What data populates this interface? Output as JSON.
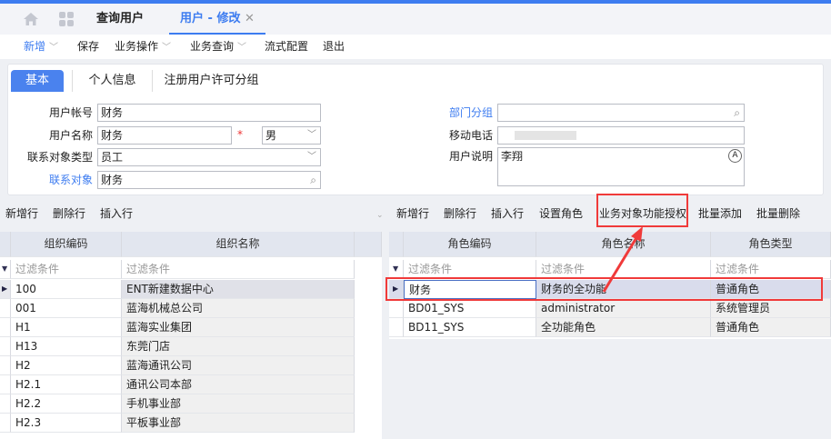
{
  "tabs": {
    "home_icon": "home-icon",
    "apps_icon": "grid-icon",
    "items": [
      {
        "label": "查询用户"
      },
      {
        "label": "用户 - 修改",
        "active": true
      }
    ],
    "close": "✕"
  },
  "toolbar": {
    "items": [
      "新增",
      "保存",
      "业务操作",
      "业务查询",
      "流式配置",
      "退出"
    ]
  },
  "form_tabs": [
    "基本",
    "个人信息",
    "注册用户许可分组"
  ],
  "form": {
    "user_account": {
      "label": "用户帐号",
      "value": "财务"
    },
    "user_name": {
      "label": "用户名称",
      "value": "财务",
      "required": "*"
    },
    "gender": {
      "value": "男"
    },
    "contact_type": {
      "label": "联系对象类型",
      "value": "员工"
    },
    "contact": {
      "label": "联系对象",
      "value": "财务"
    },
    "dept_group": {
      "label": "部门分组",
      "value": ""
    },
    "mobile": {
      "label": "移动电话",
      "value": ""
    },
    "description": {
      "label": "用户说明",
      "value": "李翔"
    }
  },
  "left_grid": {
    "toolbar": [
      "新增行",
      "删除行",
      "插入行"
    ],
    "columns": [
      "组织编码",
      "组织名称"
    ],
    "filter": "过滤条件",
    "rows": [
      [
        "100",
        "ENT新建数据中心"
      ],
      [
        "001",
        "蓝海机械总公司"
      ],
      [
        "H1",
        "蓝海实业集团"
      ],
      [
        "H13",
        "东莞门店"
      ],
      [
        "H2",
        "蓝海通讯公司"
      ],
      [
        "H2.1",
        "通讯公司本部"
      ],
      [
        "H2.2",
        "手机事业部"
      ],
      [
        "H2.3",
        "平板事业部"
      ]
    ]
  },
  "right_grid": {
    "toolbar": [
      "新增行",
      "删除行",
      "插入行",
      "设置角色",
      "业务对象功能授权",
      "批量添加",
      "批量删除"
    ],
    "columns": [
      "角色编码",
      "角色名称",
      "角色类型"
    ],
    "filter": "过滤条件",
    "rows": [
      [
        "财务",
        "财务的全功能",
        "普通角色"
      ],
      [
        "BD01_SYS",
        "administrator",
        "系统管理员"
      ],
      [
        "BD11_SYS",
        "全功能角色",
        "普通角色"
      ]
    ]
  },
  "colors": {
    "accent": "#3d7cf0",
    "highlight": "#f03a3a",
    "selected_row": "#d9dcec"
  }
}
